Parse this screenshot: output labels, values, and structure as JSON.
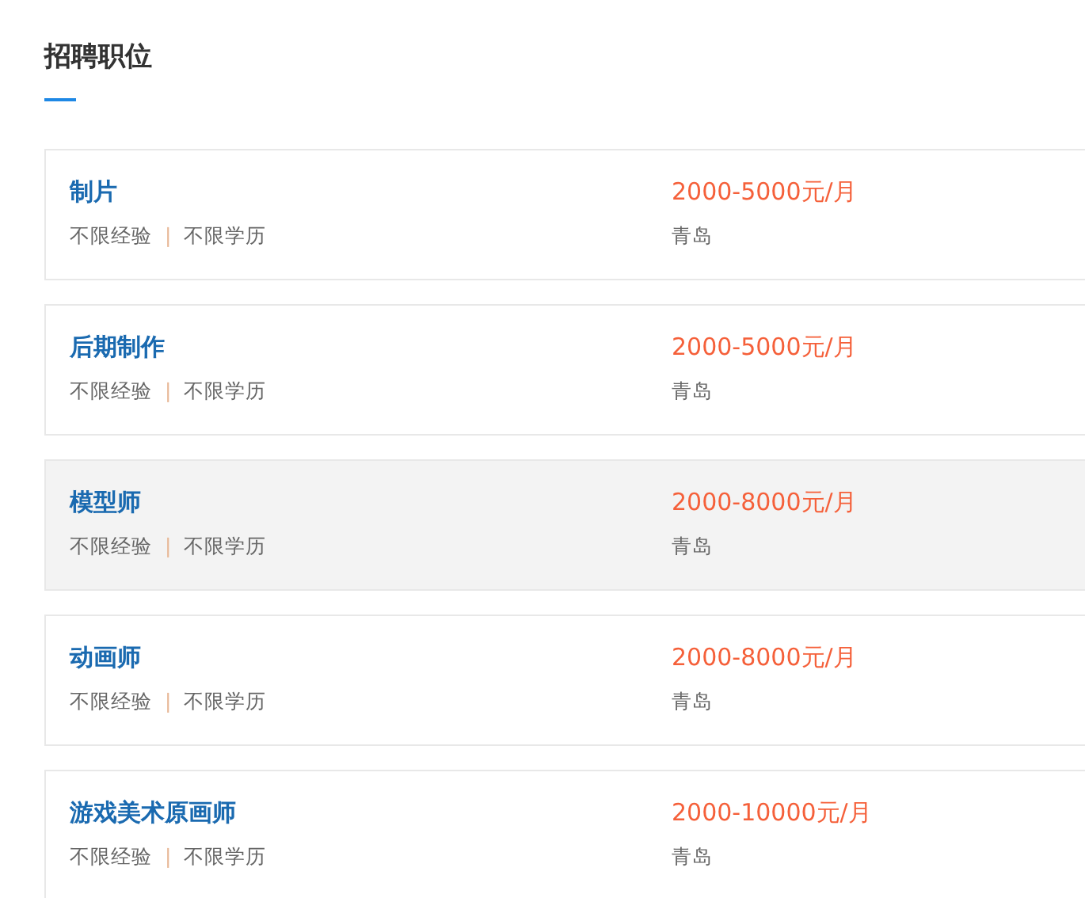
{
  "section": {
    "title": "招聘职位"
  },
  "jobs": [
    {
      "title": "制片",
      "experience": "不限经验",
      "separator": "|",
      "education": "不限学历",
      "salary": "2000-5000元/月",
      "location": "青岛",
      "highlighted": false
    },
    {
      "title": "后期制作",
      "experience": "不限经验",
      "separator": "|",
      "education": "不限学历",
      "salary": "2000-5000元/月",
      "location": "青岛",
      "highlighted": false
    },
    {
      "title": "模型师",
      "experience": "不限经验",
      "separator": "|",
      "education": "不限学历",
      "salary": "2000-8000元/月",
      "location": "青岛",
      "highlighted": true
    },
    {
      "title": "动画师",
      "experience": "不限经验",
      "separator": "|",
      "education": "不限学历",
      "salary": "2000-8000元/月",
      "location": "青岛",
      "highlighted": false
    },
    {
      "title": "游戏美术原画师",
      "experience": "不限经验",
      "separator": "|",
      "education": "不限学历",
      "salary": "2000-10000元/月",
      "location": "青岛",
      "highlighted": false
    }
  ]
}
